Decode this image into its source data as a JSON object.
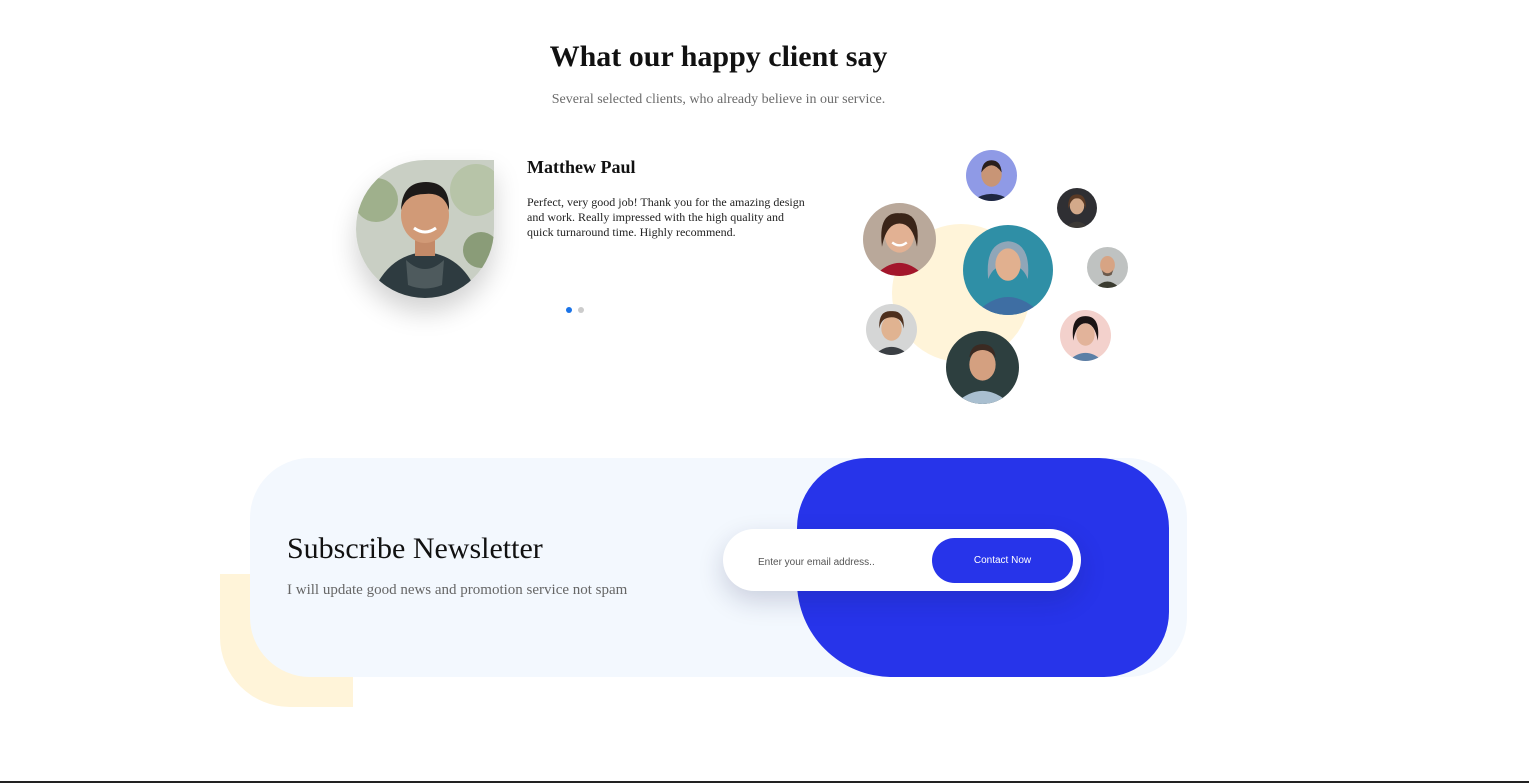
{
  "section": {
    "title": "What our happy client say",
    "subtitle": "Several selected clients, who already believe in our service."
  },
  "testimonial": {
    "name": "Matthew Paul",
    "quote": "Perfect, very good job! Thank you for the amazing design and work. Really impressed with the high quality and quick turnaround time. Highly recommend.",
    "active_slide": 1,
    "slide_count": 2
  },
  "newsletter": {
    "title": "Subscribe Newsletter",
    "subtitle": "I will update good news and promotion service not spam",
    "email_placeholder": "Enter your email address..",
    "button_label": "Contact Now"
  },
  "colors": {
    "accent_blue": "#2734ea",
    "dot_active": "#1a73e8",
    "dot_inactive": "#cccccc",
    "cream": "#fff4d9",
    "panel_bg": "#f3f8fe"
  }
}
